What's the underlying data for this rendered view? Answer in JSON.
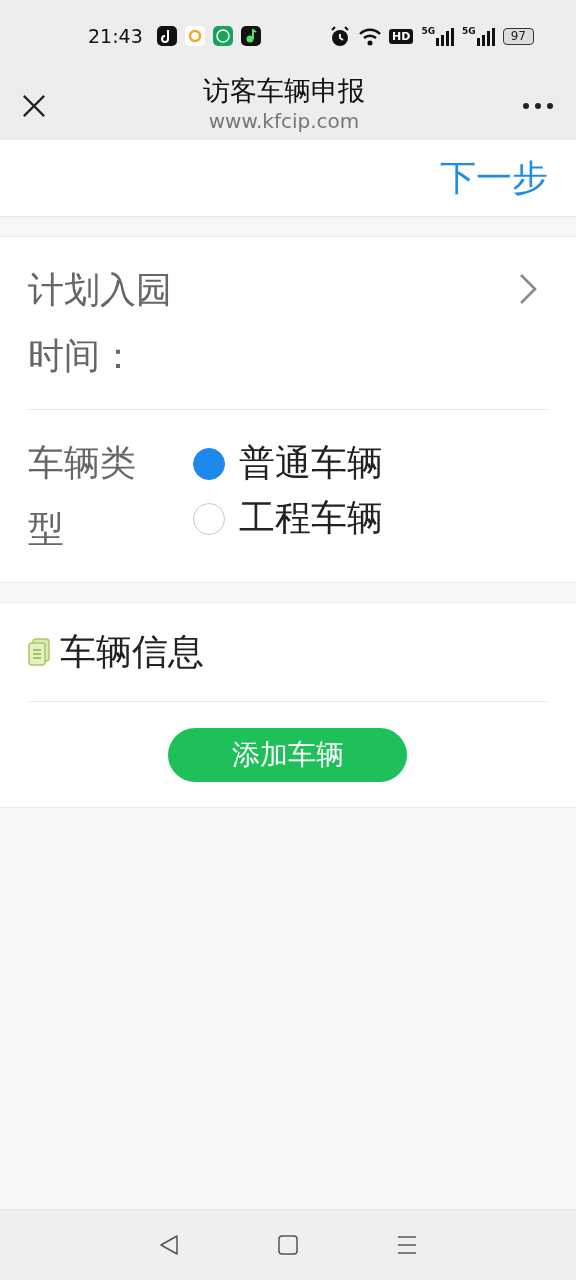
{
  "status_bar": {
    "time": "21:43",
    "hd_label": "HD",
    "network_labels": [
      "5G",
      "5G"
    ],
    "battery": "97"
  },
  "header": {
    "title": "访客车辆申报",
    "url": "www.kfcip.com"
  },
  "top_action": {
    "label": "下一步"
  },
  "form_rows": [
    {
      "kind": "picker",
      "label": "计划入园时间："
    },
    {
      "kind": "radio",
      "label": "车辆类型",
      "options": [
        {
          "label": "普通车辆",
          "selected": true
        },
        {
          "label": "工程车辆",
          "selected": false
        }
      ]
    }
  ],
  "vehicle_section": {
    "title": "车辆信息",
    "button": "添加车辆"
  }
}
